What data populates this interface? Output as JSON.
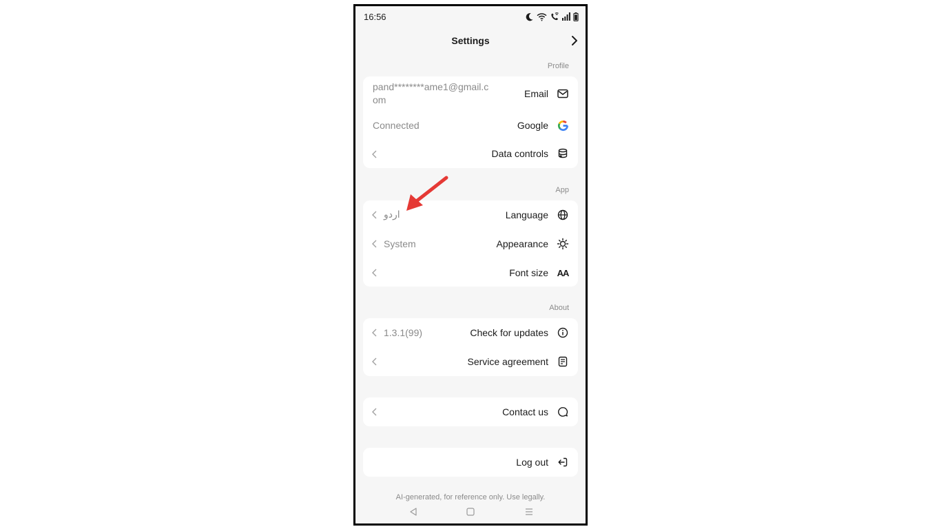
{
  "status_bar": {
    "time": "16:56",
    "icons": [
      "moon-icon",
      "wifi-icon",
      "wifi-call-icon",
      "signal-icon",
      "battery-icon"
    ]
  },
  "header": {
    "title": "Settings",
    "forward_icon": "chevron-right-icon"
  },
  "sections": {
    "profile": {
      "label": "Profile",
      "rows": {
        "email": {
          "label": "Email",
          "value": "pand********ame1@gmail.com",
          "icon": "mail-icon"
        },
        "google": {
          "label": "Google",
          "value": "Connected",
          "icon": "google-icon"
        },
        "data_controls": {
          "label": "Data controls",
          "icon": "database-icon"
        }
      }
    },
    "app": {
      "label": "App",
      "rows": {
        "language": {
          "label": "Language",
          "value": "اردو",
          "icon": "globe-icon"
        },
        "appearance": {
          "label": "Appearance",
          "value": "System",
          "icon": "sun-icon"
        },
        "font_size": {
          "label": "Font size",
          "icon": "font-size-icon",
          "icon_glyph": "AA"
        }
      }
    },
    "about": {
      "label": "About",
      "rows": {
        "updates": {
          "label": "Check for updates",
          "value": "1.3.1(99)",
          "icon": "info-icon"
        },
        "service": {
          "label": "Service agreement",
          "icon": "document-icon"
        }
      }
    },
    "contact": {
      "rows": {
        "contact_us": {
          "label": "Contact us",
          "icon": "chat-bubble-icon"
        }
      }
    },
    "logout": {
      "rows": {
        "log_out": {
          "label": "Log out",
          "icon": "logout-icon"
        }
      }
    }
  },
  "footer": {
    "disclaimer": "AI-generated, for reference only. Use legally."
  },
  "nav_bar": {
    "buttons": [
      "back-icon",
      "home-icon",
      "recents-icon"
    ]
  },
  "colors": {
    "background": "#f6f6f6",
    "card": "#ffffff",
    "text_primary": "#1b1b1b",
    "text_secondary": "#8a8a8a",
    "annotation_arrow": "#e53935"
  }
}
